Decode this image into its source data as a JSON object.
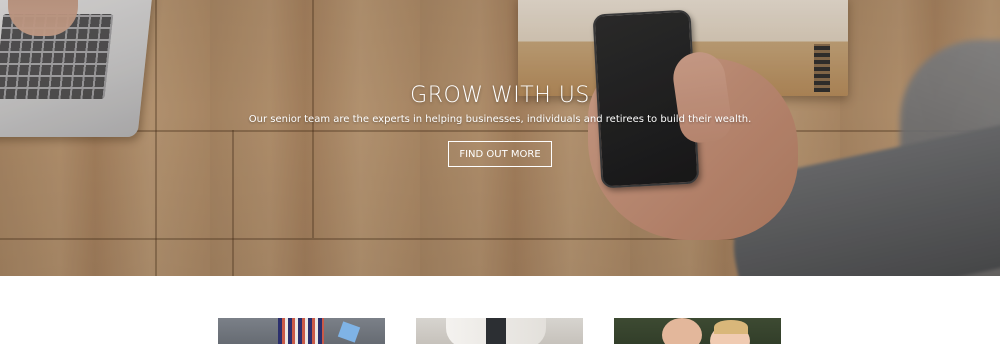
{
  "hero": {
    "title": "GROW WITH US",
    "subtitle": "Our senior team are the experts in helping businesses, individuals and retirees to build their wealth.",
    "button_label": "FIND OUT MORE"
  },
  "cards": [
    {
      "name": "team-photo-suit"
    },
    {
      "name": "team-photo-shirts"
    },
    {
      "name": "team-photo-children"
    }
  ],
  "colors": {
    "hero_text": "#ffffff",
    "page_background": "#ffffff"
  }
}
